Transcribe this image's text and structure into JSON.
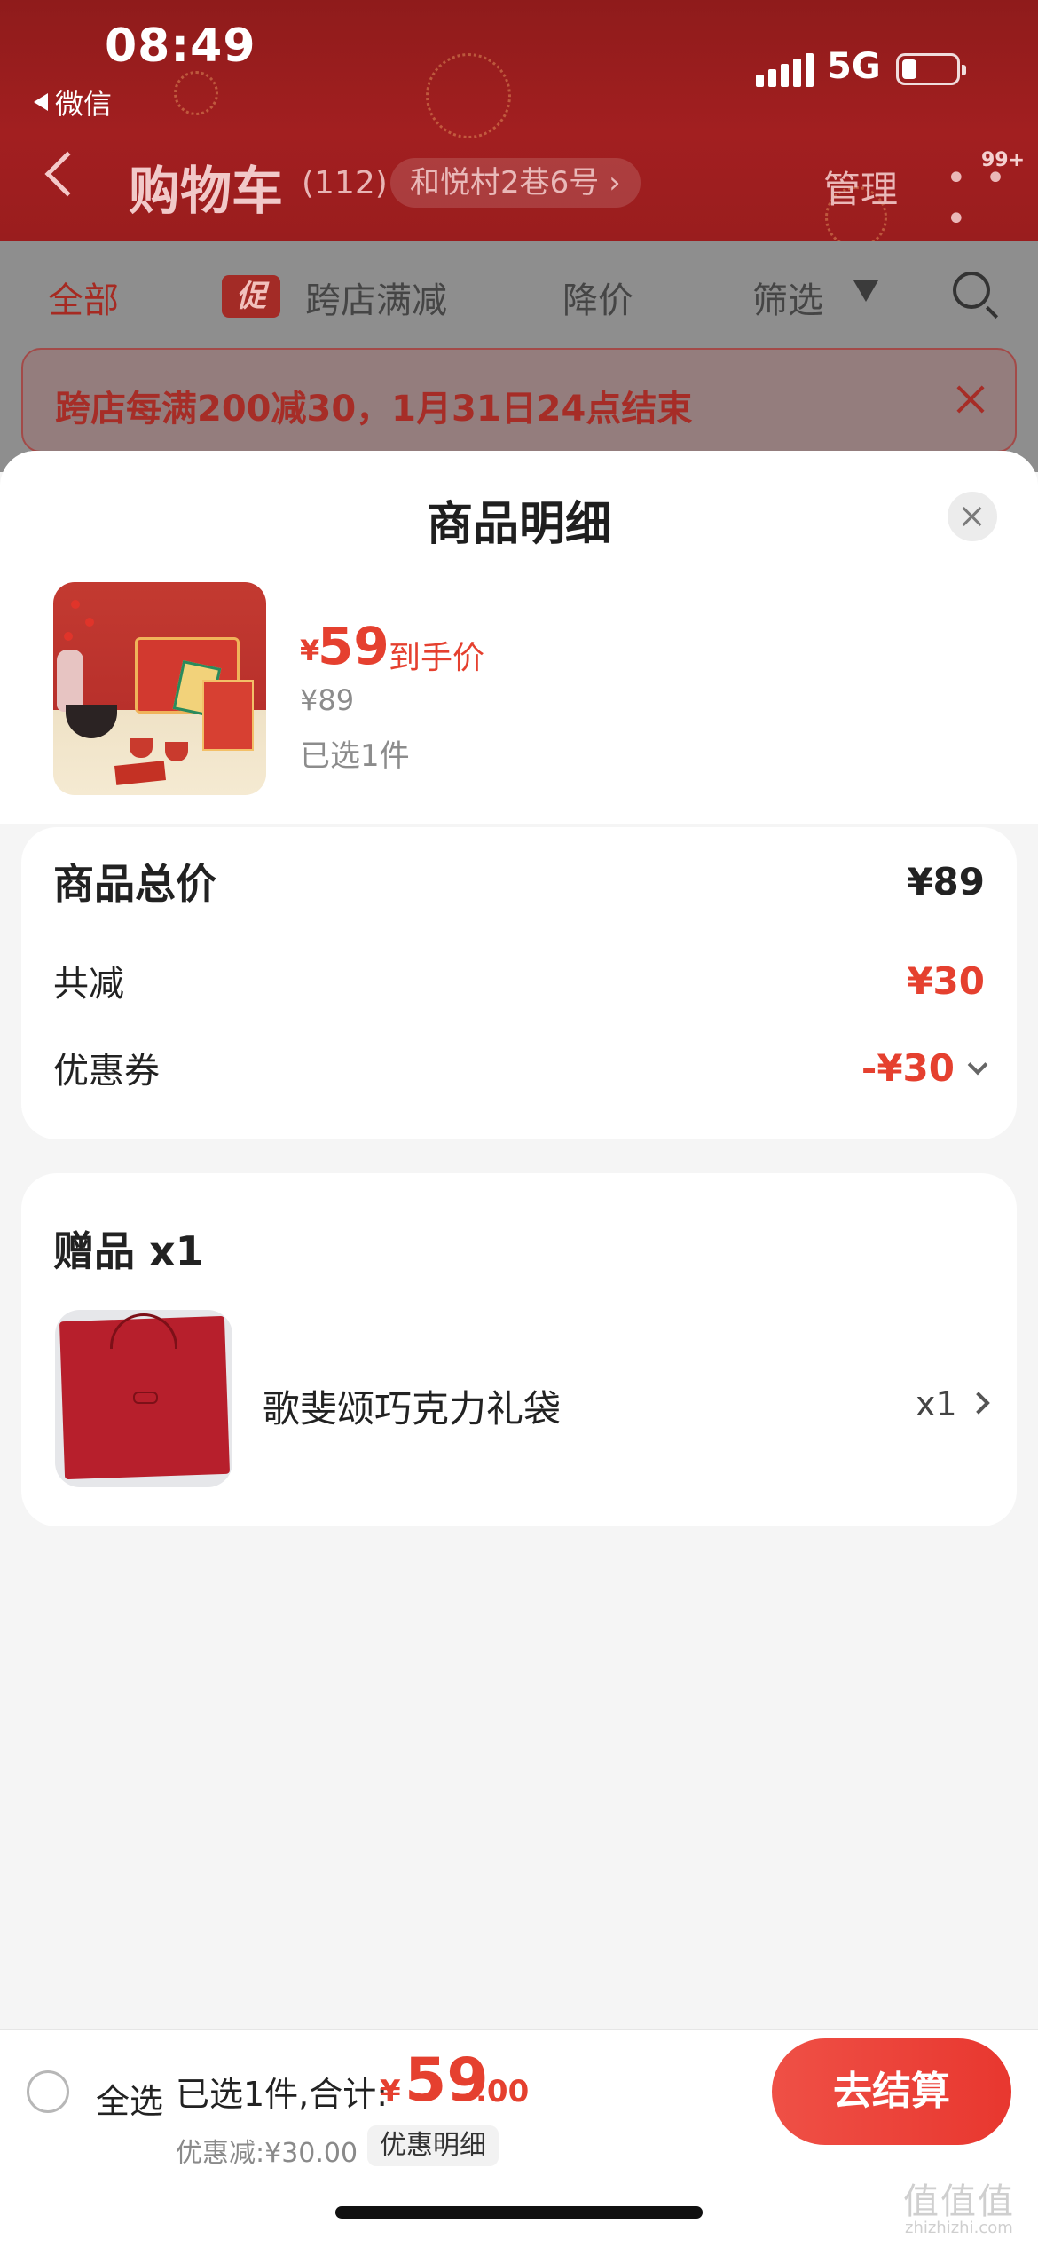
{
  "status": {
    "time": "08:49",
    "back_app": "微信",
    "network": "5G"
  },
  "nav": {
    "title": "购物车",
    "count": "(112)",
    "address": "和悦村2巷6号 ›",
    "manage": "管理",
    "more": "• • •",
    "badge": "99+"
  },
  "filters": {
    "all": "全部",
    "promo_tag": "促",
    "cross_store": "跨店满减",
    "price_drop": "降价",
    "filter": "筛选"
  },
  "banner": {
    "text": "跨店每满200减30，1月31日24点结束"
  },
  "sheet": {
    "title": "商品明细",
    "product": {
      "currency": "¥",
      "final_price": "59",
      "final_label": "到手价",
      "original_price": "¥89",
      "selected": "已选1件"
    }
  },
  "summary": {
    "total_label": "商品总价",
    "total_value": "¥89",
    "reduce_label": "共减",
    "reduce_value": "¥30",
    "coupon_label": "优惠券",
    "coupon_value": "-¥30"
  },
  "gift": {
    "title": "赠品 x1",
    "name": "歌斐颂巧克力礼袋",
    "qty": "x1"
  },
  "bottom": {
    "select_all": "全选",
    "selected_total": "已选1件,合计:",
    "currency": "¥",
    "total_int": "59",
    "total_dec": ".00",
    "discount": "优惠减:¥30.00",
    "discount_detail": "优惠明细",
    "checkout": "去结算"
  },
  "watermark": {
    "logo": "值值值",
    "url": "zhizhizhi.com"
  },
  "colors": {
    "accent": "#e5402f",
    "header": "#9a1d1e"
  }
}
